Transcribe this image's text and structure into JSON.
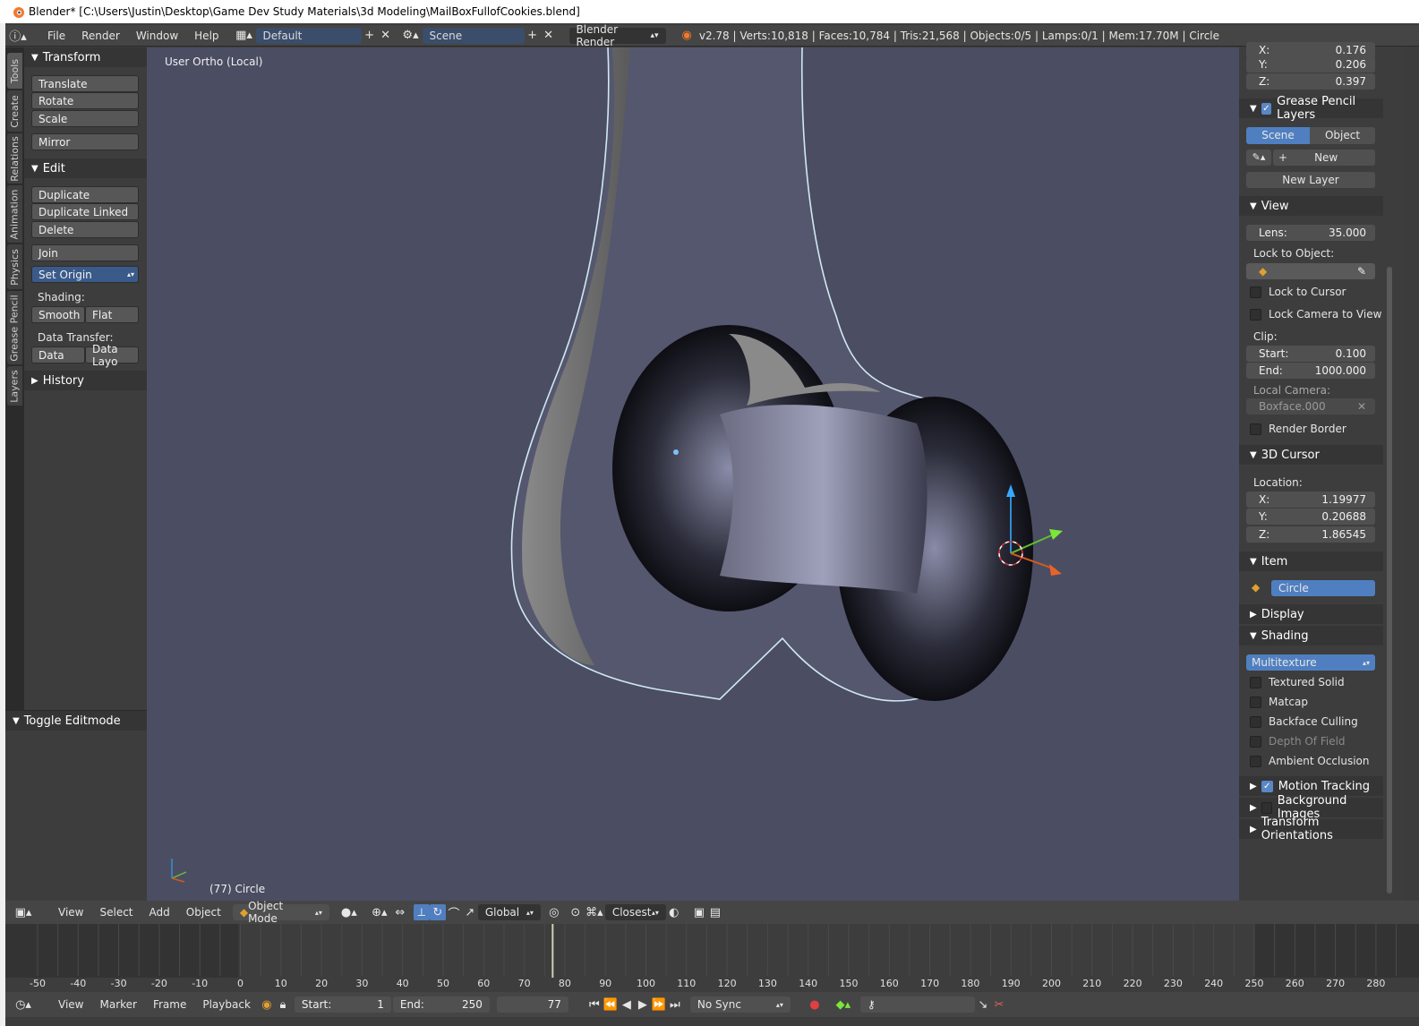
{
  "window": {
    "title": "Blender* [C:\\Users\\Justin\\Desktop\\Game Dev Study Materials\\3d Modeling\\MailBoxFullofCookies.blend]"
  },
  "topbar": {
    "menus": [
      "File",
      "Render",
      "Window",
      "Help"
    ],
    "layout": "Default",
    "scene": "Scene",
    "engine": "Blender Render",
    "stats": "v2.78 | Verts:10,818 | Faces:10,784 | Tris:21,568 | Objects:0/5 | Lamps:0/1 | Mem:17.70M | Circle"
  },
  "lefttabs": [
    "Tools",
    "Create",
    "Relations",
    "Animation",
    "Physics",
    "Grease Pencil",
    "Layers"
  ],
  "toolshelf": {
    "transform_title": "Transform",
    "translate": "Translate",
    "rotate": "Rotate",
    "scale": "Scale",
    "mirror": "Mirror",
    "edit_title": "Edit",
    "duplicate": "Duplicate",
    "duplicate_linked": "Duplicate Linked",
    "delete": "Delete",
    "join": "Join",
    "set_origin": "Set Origin",
    "shading_label": "Shading:",
    "smooth": "Smooth",
    "flat": "Flat",
    "data_transfer_label": "Data Transfer:",
    "data": "Data",
    "data_layo": "Data Layo",
    "history_title": "History",
    "toggle_editmode": "Toggle Editmode"
  },
  "viewport": {
    "view_label": "User Ortho (Local)",
    "object_label": "(77) Circle",
    "axis_x": "x",
    "axis_y": "y",
    "axis_z": "z"
  },
  "rightpanel": {
    "x_partial": "X:",
    "x_partial_val": "0.176",
    "y": "Y:",
    "y_val": "0.206",
    "z": "Z:",
    "z_val": "0.397",
    "grease_title": "Grease Pencil Layers",
    "scene_btn": "Scene",
    "object_btn": "Object",
    "new_btn": "New",
    "new_layer": "New Layer",
    "view_title": "View",
    "lens": "Lens:",
    "lens_val": "35.000",
    "lock_to_object": "Lock to Object:",
    "lock_to_cursor": "Lock to Cursor",
    "lock_camera": "Lock Camera to View",
    "clip": "Clip:",
    "start": "Start:",
    "start_val": "0.100",
    "end": "End:",
    "end_val": "1000.000",
    "local_camera": "Local Camera:",
    "camera_val": "Boxface.000",
    "render_border": "Render Border",
    "cursor_title": "3D Cursor",
    "location": "Location:",
    "cx": "X:",
    "cx_val": "1.19977",
    "cy": "Y:",
    "cy_val": "0.20688",
    "cz": "Z:",
    "cz_val": "1.86545",
    "item_title": "Item",
    "item_name": "Circle",
    "display_title": "Display",
    "shading_title": "Shading",
    "shading_mode": "Multitexture",
    "textured_solid": "Textured Solid",
    "matcap": "Matcap",
    "backface": "Backface Culling",
    "dof": "Depth Of Field",
    "ao": "Ambient Occlusion",
    "motion_tracking": "Motion Tracking",
    "background_images": "Background Images",
    "transform_orient": "Transform Orientations"
  },
  "bottomhdr": {
    "menus": [
      "View",
      "Select",
      "Add",
      "Object"
    ],
    "mode": "Object Mode",
    "orientation": "Global",
    "snap": "Closest"
  },
  "timeline": {
    "ticks": [
      "-50",
      "-40",
      "-30",
      "-20",
      "-10",
      "0",
      "10",
      "20",
      "30",
      "40",
      "50",
      "60",
      "70",
      "80",
      "90",
      "100",
      "110",
      "120",
      "130",
      "140",
      "150",
      "160",
      "170",
      "180",
      "190",
      "200",
      "210",
      "220",
      "230",
      "240",
      "250",
      "260",
      "270",
      "280"
    ]
  },
  "timebar": {
    "menus": [
      "View",
      "Marker",
      "Frame",
      "Playback"
    ],
    "start_label": "Start:",
    "start_val": "1",
    "end_label": "End:",
    "end_val": "250",
    "current_frame": "77",
    "sync": "No Sync"
  }
}
